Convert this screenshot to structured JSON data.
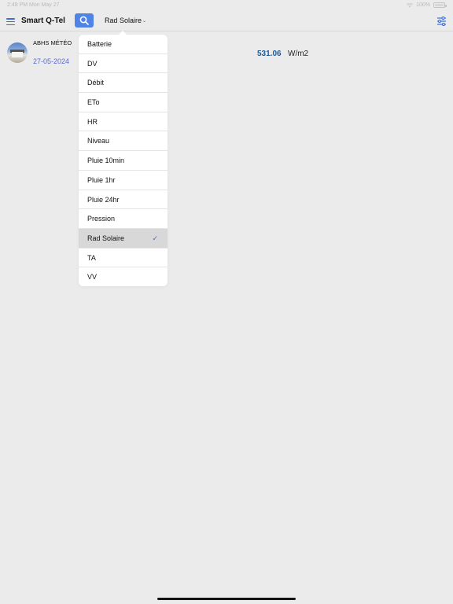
{
  "status_bar": {
    "time": "2:48 PM  Mon May 27",
    "battery": "100%",
    "battery_level": 1.0
  },
  "nav": {
    "title": "Smart Q-Tel",
    "selected_metric": "Rad Solaire"
  },
  "station": {
    "name": "ABHS MÉTÉO",
    "date": "27-05-2024",
    "value": "531.06",
    "unit": "W/m2"
  },
  "dropdown": {
    "items": [
      {
        "label": "Batterie"
      },
      {
        "label": "DV"
      },
      {
        "label": "Débit"
      },
      {
        "label": "ETo"
      },
      {
        "label": "HR"
      },
      {
        "label": "Niveau"
      },
      {
        "label": "Pluie 10min"
      },
      {
        "label": "Pluie 1hr"
      },
      {
        "label": "Pluie 24hr"
      },
      {
        "label": "Pression"
      },
      {
        "label": "Rad Solaire",
        "selected": true
      },
      {
        "label": "TA"
      },
      {
        "label": "VV"
      }
    ],
    "check_mark": "✓"
  },
  "colors": {
    "accent": "#4f84e6",
    "value": "#1e5a9a",
    "date": "#5a6ad6"
  },
  "icons": [
    "menu-icon",
    "search-icon",
    "chevron-down-icon",
    "filter-icon",
    "check-icon",
    "wifi-icon",
    "battery-icon"
  ]
}
